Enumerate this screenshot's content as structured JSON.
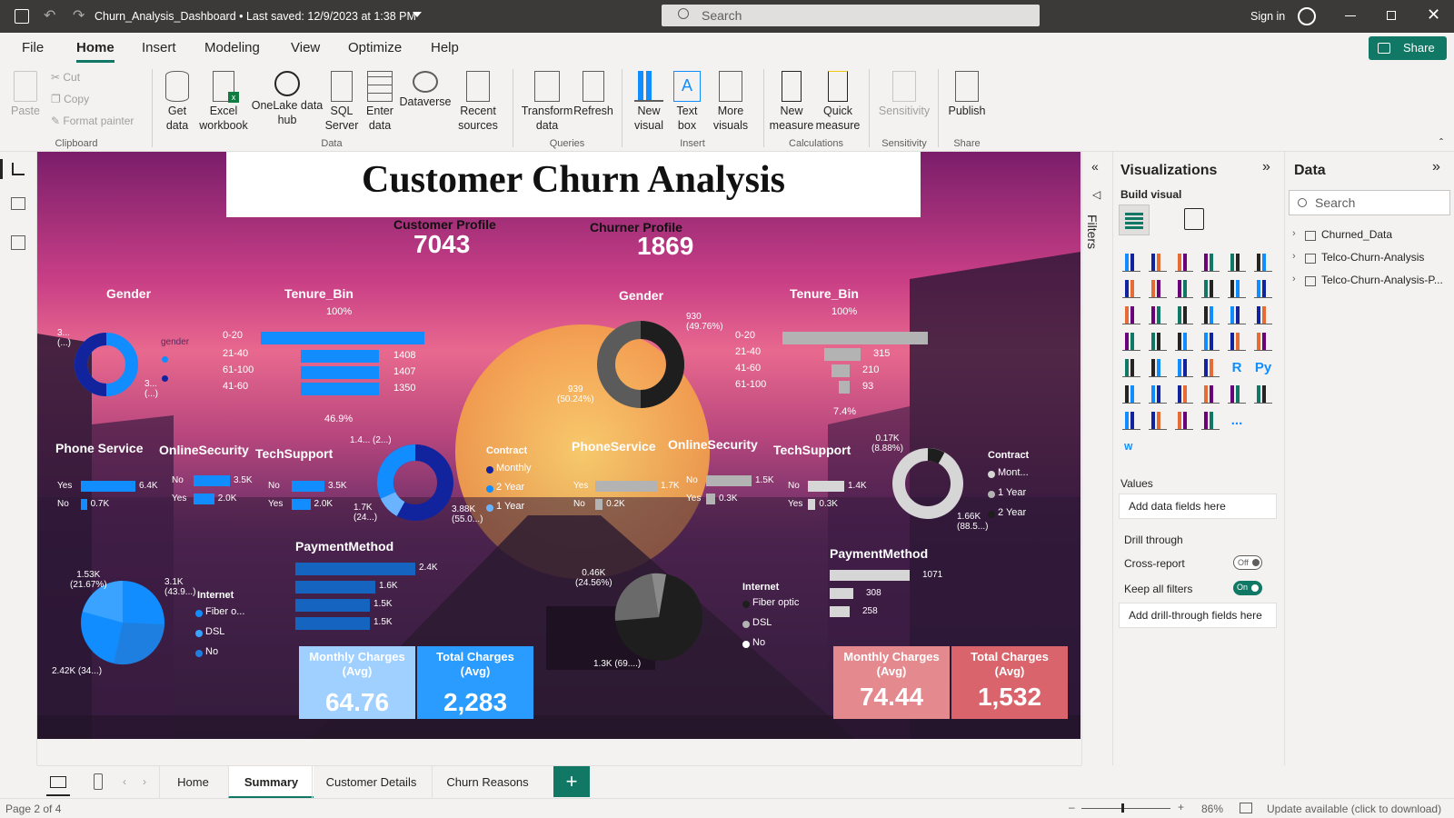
{
  "window": {
    "title": "Churn_Analysis_Dashboard • Last saved: 12/9/2023 at 1:38 PM",
    "search_placeholder": "Search",
    "sign_in": "Sign in"
  },
  "menu": {
    "items": [
      "File",
      "Home",
      "Insert",
      "Modeling",
      "View",
      "Optimize",
      "Help"
    ],
    "share": "Share"
  },
  "ribbon": {
    "clipboard": {
      "paste": "Paste",
      "cut": "Cut",
      "copy": "Copy",
      "format_painter": "Format painter",
      "group": "Clipboard"
    },
    "data": {
      "get_data": "Get data",
      "excel": "Excel workbook",
      "onelake": "OneLake data hub",
      "sql": "SQL Server",
      "enter": "Enter data",
      "dataverse": "Dataverse",
      "recent": "Recent sources",
      "group": "Data"
    },
    "queries": {
      "transform": "Transform data",
      "refresh": "Refresh",
      "group": "Queries"
    },
    "insert": {
      "new_visual": "New visual",
      "text_box": "Text box",
      "more_visuals": "More visuals",
      "group": "Insert"
    },
    "calc": {
      "new_measure": "New measure",
      "quick_measure": "Quick measure",
      "group": "Calculations"
    },
    "sensitivity": {
      "label": "Sensitivity",
      "group": "Sensitivity"
    },
    "share": {
      "publish": "Publish",
      "group": "Share"
    }
  },
  "report": {
    "title": "Customer Churn Analysis",
    "customer_profile": {
      "label": "Customer Profile",
      "value": "7043"
    },
    "churner_profile": {
      "label": "Churner Profile",
      "value": "1869"
    },
    "left": {
      "gender": {
        "title": "Gender",
        "legend_title": "gender",
        "label_a": "3...\n(...)",
        "label_b": "3...\n(...)"
      },
      "tenure": {
        "title": "Tenure_Bin",
        "top": "100%",
        "bottom": "46.9%",
        "rows": [
          {
            "label": "0-20",
            "value": ""
          },
          {
            "label": "21-40",
            "value": "1408"
          },
          {
            "label": "61-100",
            "value": "1407"
          },
          {
            "label": "41-60",
            "value": "1350"
          }
        ]
      },
      "phone": {
        "title": "Phone Service",
        "rows": [
          {
            "label": "Yes",
            "value": "6.4K"
          },
          {
            "label": "No",
            "value": "0.7K"
          }
        ]
      },
      "security": {
        "title": "OnlineSecurity",
        "rows": [
          {
            "label": "No",
            "value": "3.5K"
          },
          {
            "label": "Yes",
            "value": "2.0K"
          }
        ]
      },
      "tech": {
        "title": "TechSupport",
        "rows": [
          {
            "label": "No",
            "value": "3.5K"
          },
          {
            "label": "Yes",
            "value": "2.0K"
          }
        ],
        "extra": "1.7K\n(24...)"
      },
      "contract": {
        "title": "Contract",
        "items": [
          "Monthly",
          "2 Year",
          "1 Year"
        ],
        "label_top": "1.4... (2...)",
        "label_bottom": "3.88K\n(55.0...)"
      },
      "payment": {
        "title": "PaymentMethod",
        "values": [
          "2.4K",
          "1.6K",
          "1.5K",
          "1.5K"
        ]
      },
      "internet": {
        "title": "Internet",
        "items": [
          "Fiber o...",
          "DSL",
          "No"
        ],
        "label_a": "1.53K\n(21.67%)",
        "label_b": "3.1K\n(43.9...)",
        "label_c": "2.42K (34...)"
      },
      "monthly": {
        "label": "Monthly Charges (Avg)",
        "value": "64.76"
      },
      "total": {
        "label": "Total Charges (Avg)",
        "value": "2,283"
      }
    },
    "right": {
      "gender": {
        "title": "Gender",
        "label_a": "930\n(49.76%)",
        "label_b": "939\n(50.24%)"
      },
      "tenure": {
        "title": "Tenure_Bin",
        "top": "100%",
        "bottom": "7.4%",
        "rows": [
          {
            "label": "0-20",
            "value": ""
          },
          {
            "label": "21-40",
            "value": "315"
          },
          {
            "label": "41-60",
            "value": "210"
          },
          {
            "label": "61-100",
            "value": "93"
          }
        ]
      },
      "phone": {
        "title": "PhoneService",
        "rows": [
          {
            "label": "Yes",
            "value": "1.7K"
          },
          {
            "label": "No",
            "value": "0.2K"
          }
        ]
      },
      "security": {
        "title": "OnlineSecurity",
        "rows": [
          {
            "label": "No",
            "value": "1.5K"
          },
          {
            "label": "Yes",
            "value": "0.3K"
          }
        ]
      },
      "tech": {
        "title": "TechSupport",
        "rows": [
          {
            "label": "No",
            "value": "1.4K"
          },
          {
            "label": "Yes",
            "value": "0.3K"
          }
        ]
      },
      "contract": {
        "title": "Contract",
        "items": [
          "Mont...",
          "1 Year",
          "2 Year"
        ],
        "label_top": "0.17K\n(8.88%)",
        "label_bottom": "1.66K\n(88.5...)"
      },
      "payment": {
        "title": "PaymentMethod",
        "values": [
          "1071",
          "308",
          "258"
        ]
      },
      "internet": {
        "title": "Internet",
        "items": [
          "Fiber optic",
          "DSL",
          "No"
        ],
        "label_a": "0.46K\n(24.56%)",
        "label_b": "1.3K (69....)"
      },
      "monthly": {
        "label": "Monthly Charges (Avg)",
        "value": "74.44"
      },
      "total": {
        "label": "Total Charges (Avg)",
        "value": "1,532"
      }
    }
  },
  "filters_label": "Filters",
  "viz": {
    "title": "Visualizations",
    "build": "Build visual",
    "values": "Values",
    "add_fields": "Add data fields here",
    "drill": "Drill through",
    "cross": "Cross-report",
    "cross_state": "Off",
    "keep": "Keep all filters",
    "keep_state": "On",
    "add_drill": "Add drill-through fields here",
    "r": "R",
    "py": "Py",
    "more": "...",
    "w": "W"
  },
  "data": {
    "title": "Data",
    "search": "Search",
    "tables": [
      "Churned_Data",
      "Telco-Churn-Analysis",
      "Telco-Churn-Analysis-P..."
    ]
  },
  "tabs": {
    "items": [
      "Home",
      "Summary",
      "Customer Details",
      "Churn Reasons"
    ],
    "active": "Summary",
    "add": "+"
  },
  "status": {
    "page": "Page 2 of 4",
    "zoom": "86%",
    "update": "Update available (click to download)"
  },
  "colors": {
    "accent": "#117865",
    "blue": "#118dff",
    "gray": "#b3b3b3"
  }
}
